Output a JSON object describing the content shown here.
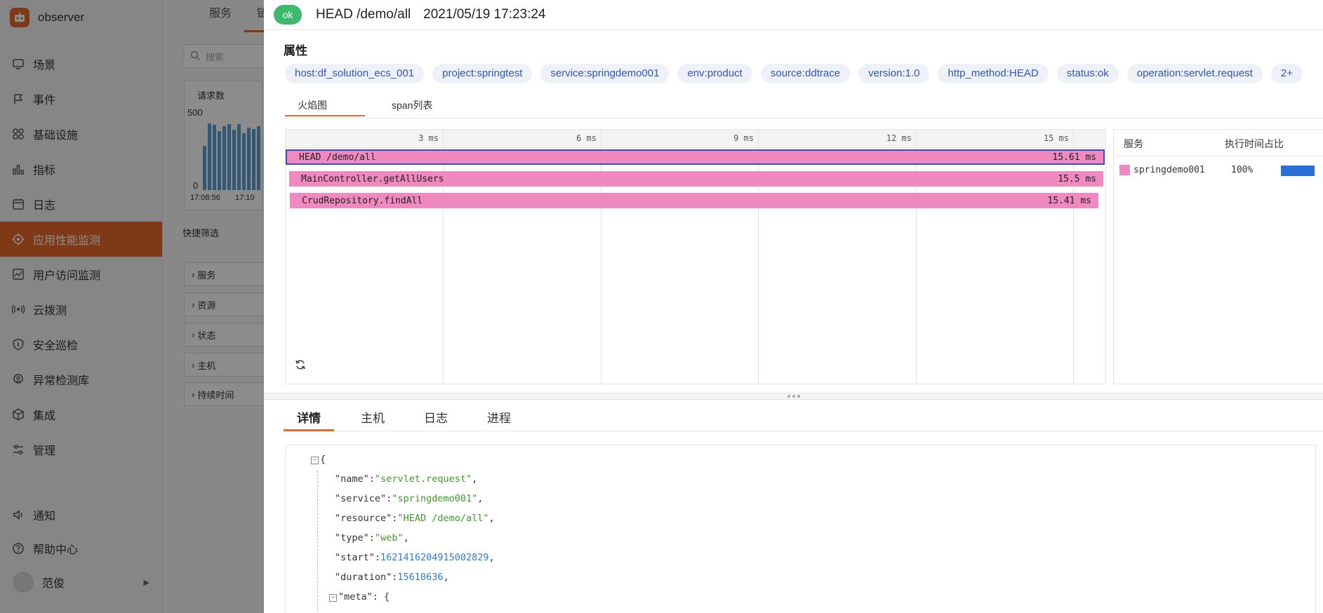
{
  "app": {
    "name": "observer",
    "brand_color": "#e8692a"
  },
  "sidebar": {
    "items": [
      {
        "label": "场景",
        "icon": "monitor-icon"
      },
      {
        "label": "事件",
        "icon": "flag-icon"
      },
      {
        "label": "基础设施",
        "icon": "grid-icon"
      },
      {
        "label": "指标",
        "icon": "bar-chart-icon"
      },
      {
        "label": "日志",
        "icon": "calendar-icon"
      },
      {
        "label": "应用性能监测",
        "icon": "target-icon",
        "active": true
      },
      {
        "label": "用户访问监测",
        "icon": "chart-board-icon"
      },
      {
        "label": "云拨测",
        "icon": "signal-icon"
      },
      {
        "label": "安全巡检",
        "icon": "shield-icon"
      },
      {
        "label": "异常检测库",
        "icon": "pin-icon"
      },
      {
        "label": "集成",
        "icon": "cube-icon"
      },
      {
        "label": "管理",
        "icon": "sliders-icon"
      }
    ],
    "bottom": [
      {
        "label": "通知",
        "icon": "speaker-icon"
      },
      {
        "label": "帮助中心",
        "icon": "help-icon"
      }
    ],
    "user": {
      "name": "范俊"
    }
  },
  "background": {
    "tabs": [
      "服务",
      "链"
    ],
    "search_placeholder": "搜索",
    "chart_title": "请求数",
    "y_top": "500",
    "y_zero": "0",
    "x_labels": [
      "17:08:56",
      "17:10"
    ],
    "quick_filter": "快捷筛选",
    "filters": [
      "服务",
      "资源",
      "状态",
      "主机",
      "持续时间"
    ]
  },
  "drawer": {
    "status": "ok",
    "status_color": "#3dba6b",
    "title": "HEAD /demo/all",
    "timestamp": "2021/05/19 17:23:24",
    "attributes_title": "属性",
    "tags": [
      "host:df_solution_ecs_001",
      "project:springtest",
      "service:springdemo001",
      "env:product",
      "source:ddtrace",
      "version:1.0",
      "http_method:HEAD",
      "status:ok",
      "operation:servlet.request",
      "2+"
    ],
    "sub_tabs": [
      "火焰图",
      "span列表"
    ],
    "flame": {
      "ticks": [
        "3 ms",
        "6 ms",
        "9 ms",
        "12 ms",
        "15 ms"
      ],
      "spans": [
        {
          "name": "HEAD /demo/all",
          "duration": "15.61 ms"
        },
        {
          "name": "MainController.getAllUsers",
          "duration": "15.5 ms"
        },
        {
          "name": "CrudRepository.findAll",
          "duration": "15.41 ms"
        }
      ]
    },
    "service_panel": {
      "col_service": "服务",
      "col_ratio": "执行时间占比",
      "rows": [
        {
          "name": "springdemo001",
          "pct": "100%"
        }
      ]
    },
    "bottom_tabs": [
      "详情",
      "主机",
      "日志",
      "进程"
    ],
    "json": {
      "name": "servlet.request",
      "service": "springdemo001",
      "resource": "HEAD /demo/all",
      "type": "web",
      "start": "1621416204915002829",
      "duration": "15610636",
      "meta_key": "meta"
    }
  }
}
